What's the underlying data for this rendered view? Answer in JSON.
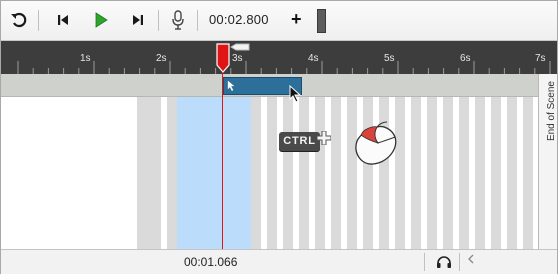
{
  "toolbar": {
    "time_readout": "00:02.800",
    "add_label": "+",
    "icons": [
      "rotate-icon",
      "skip-to-start-icon",
      "play-icon",
      "skip-to-end-icon",
      "microphone-icon"
    ]
  },
  "ruler": {
    "labels": [
      "1s",
      "2s",
      "3s",
      "4s",
      "5s",
      "6s",
      "7s"
    ]
  },
  "timeline": {
    "end_of_scene_label": "End of Scene",
    "playhead_color": "#e01414",
    "clip_color": "#2c6f9a",
    "selection_color": "#bcdcfb"
  },
  "hint": {
    "key_label": "CTRL",
    "combine_symbol": "plus-icon",
    "mouse": "mouse-left-click-icon"
  },
  "status": {
    "time": "00:01.066",
    "audio_icon": "headphones-icon",
    "scroll_icon": "scroll-left-icon"
  }
}
